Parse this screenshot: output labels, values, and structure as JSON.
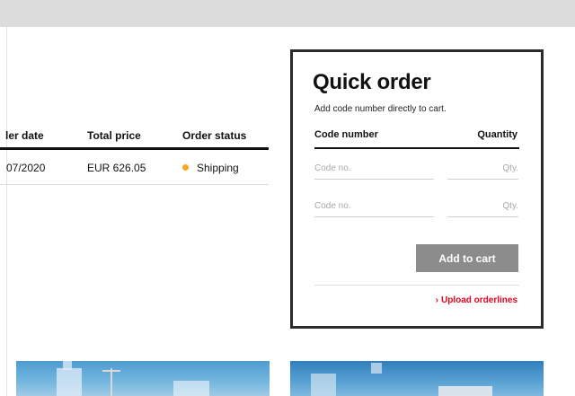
{
  "orders_table": {
    "headers": {
      "order_date": "ler date",
      "total_price": "Total price",
      "order_status": "Order status"
    },
    "rows": [
      {
        "order_date": "07/2020",
        "total_price": "EUR 626.05",
        "status": "Shipping",
        "status_color": "#f5a623"
      }
    ]
  },
  "quick_order": {
    "title": "Quick order",
    "subtitle": "Add code number directly to cart.",
    "col_code": "Code number",
    "col_quantity": "Quantity",
    "rows": [
      {
        "code_placeholder": "Code no.",
        "qty_placeholder": "Qty."
      },
      {
        "code_placeholder": "Code no.",
        "qty_placeholder": "Qty."
      }
    ],
    "add_to_cart": "Add to cart",
    "upload_link": "Upload orderlines",
    "upload_chevron": "›",
    "accent_color": "#e3051b",
    "button_color": "#8c8c8c"
  },
  "icons": {
    "status": "status-dot-icon",
    "upload": "chevron-right-icon"
  }
}
